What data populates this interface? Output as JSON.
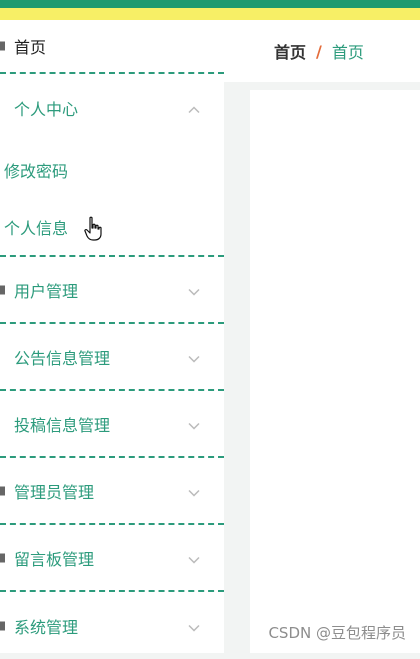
{
  "sidebar": {
    "items": [
      {
        "label": "首页",
        "icon": "home-icon"
      },
      {
        "label": "个人中心",
        "icon": "user-icon",
        "expanded": true,
        "children": [
          {
            "label": "修改密码"
          },
          {
            "label": "个人信息"
          }
        ]
      },
      {
        "label": "用户管理",
        "icon": "users-icon"
      },
      {
        "label": "公告信息管理",
        "icon": "notice-icon"
      },
      {
        "label": "投稿信息管理",
        "icon": "submit-icon"
      },
      {
        "label": "管理员管理",
        "icon": "admin-icon"
      },
      {
        "label": "留言板管理",
        "icon": "message-icon"
      },
      {
        "label": "系统管理",
        "icon": "settings-icon"
      }
    ]
  },
  "breadcrumb": {
    "home": "首页",
    "separator": "/",
    "current": "首页"
  },
  "watermark": "CSDN @豆包程序员",
  "colors": {
    "accent": "#2c9b7c",
    "topbar_green": "#1f9a6f",
    "topbar_yellow": "#f7ef66",
    "separator": "#e46c3b"
  }
}
